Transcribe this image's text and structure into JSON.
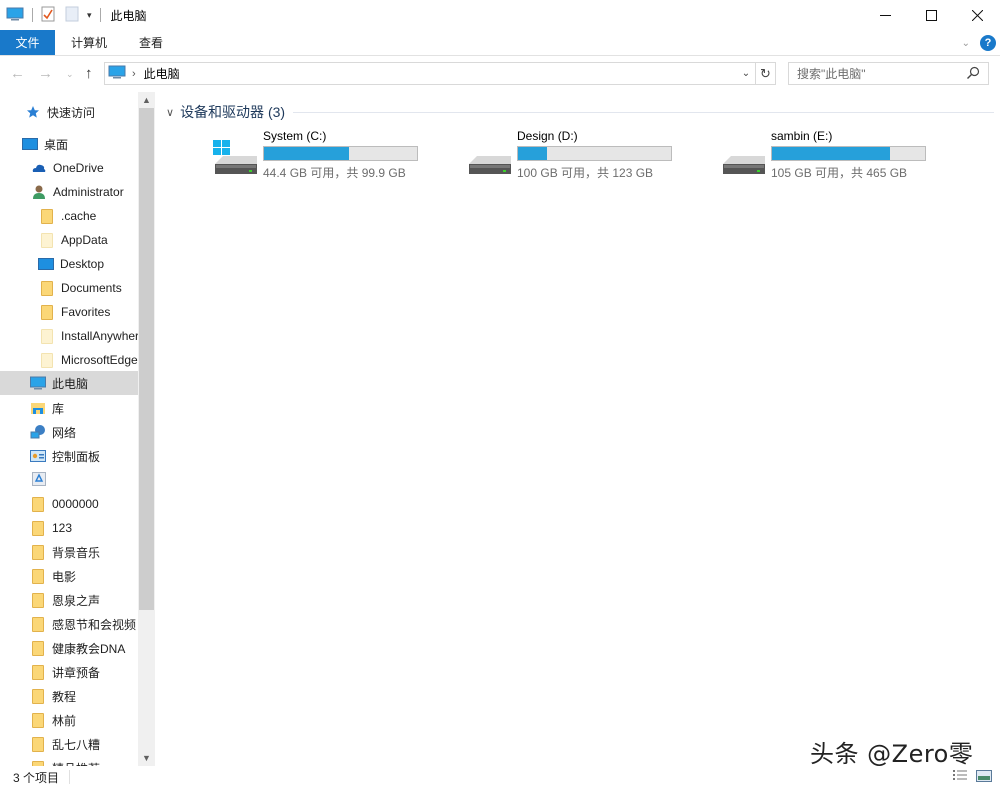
{
  "window": {
    "title": "此电脑",
    "controls": {
      "minimize": "minimize",
      "maximize": "maximize",
      "close": "close"
    }
  },
  "quick_access_toolbar": {
    "icons": [
      "computer-icon",
      "properties-icon",
      "new-folder-icon",
      "customize-dropdown-icon"
    ]
  },
  "ribbon": {
    "tabs": [
      {
        "label": "文件",
        "active": true
      },
      {
        "label": "计算机"
      },
      {
        "label": "查看"
      }
    ],
    "accent": "#1979ca"
  },
  "address_bar": {
    "breadcrumb": [
      "此电脑"
    ],
    "search_placeholder": "搜索\"此电脑\""
  },
  "nav_pane": {
    "items": [
      {
        "label": "快速访问",
        "icon": "star-icon",
        "indent": 1
      },
      {
        "label": "桌面",
        "icon": "desktop-icon",
        "indent": 0
      },
      {
        "label": "OneDrive",
        "icon": "cloud-icon",
        "indent": 1
      },
      {
        "label": "Administrator",
        "icon": "user-icon",
        "indent": 1
      },
      {
        "label": ".cache",
        "icon": "folder-icon",
        "indent": 2
      },
      {
        "label": "AppData",
        "icon": "folder-hidden-icon",
        "indent": 2
      },
      {
        "label": "Desktop",
        "icon": "desktop-icon",
        "indent": 2
      },
      {
        "label": "Documents",
        "icon": "folder-icon",
        "indent": 2
      },
      {
        "label": "Favorites",
        "icon": "folder-icon",
        "indent": 2
      },
      {
        "label": "InstallAnywhere",
        "icon": "folder-hidden-icon",
        "indent": 2
      },
      {
        "label": "MicrosoftEdgeBackups",
        "icon": "folder-hidden-icon",
        "indent": 2
      },
      {
        "label": "此电脑",
        "icon": "computer-icon",
        "indent": 1,
        "selected": true
      },
      {
        "label": "库",
        "icon": "library-icon",
        "indent": 1
      },
      {
        "label": "网络",
        "icon": "network-icon",
        "indent": 1
      },
      {
        "label": "控制面板",
        "icon": "control-panel-icon",
        "indent": 1
      },
      {
        "label": "",
        "icon": "recycle-bin-icon",
        "indent": 1
      },
      {
        "label": "0000000",
        "icon": "folder-icon",
        "indent": 1
      },
      {
        "label": "123",
        "icon": "folder-icon",
        "indent": 1
      },
      {
        "label": "背景音乐",
        "icon": "folder-icon",
        "indent": 1
      },
      {
        "label": "电影",
        "icon": "folder-icon",
        "indent": 1
      },
      {
        "label": "恩泉之声",
        "icon": "folder-icon",
        "indent": 1
      },
      {
        "label": "感恩节和会视频",
        "icon": "folder-icon",
        "indent": 1
      },
      {
        "label": "健康教会DNA",
        "icon": "folder-icon",
        "indent": 1
      },
      {
        "label": "讲章预备",
        "icon": "folder-icon",
        "indent": 1
      },
      {
        "label": "教程",
        "icon": "folder-icon",
        "indent": 1
      },
      {
        "label": "林前",
        "icon": "folder-icon",
        "indent": 1
      },
      {
        "label": "乱七八糟",
        "icon": "folder-icon",
        "indent": 1
      },
      {
        "label": "精品推荐",
        "icon": "folder-icon",
        "indent": 1
      }
    ]
  },
  "content": {
    "group_label": "设备和驱动器 (3)",
    "drives": [
      {
        "name": "System (C:)",
        "info": "44.4 GB 可用，共 99.9 GB",
        "used_percent": 55.6,
        "icon": "system-drive-icon"
      },
      {
        "name": "Design (D:)",
        "info": "100 GB 可用，共 123 GB",
        "used_percent": 18.7,
        "icon": "drive-icon"
      },
      {
        "name": "sambin (E:)",
        "info": "105 GB 可用，共 465 GB",
        "used_percent": 77.4,
        "icon": "drive-icon"
      }
    ],
    "bar_color": "#26a0da"
  },
  "status_bar": {
    "item_count": "3 个项目"
  },
  "watermark": "头条 @Zero零"
}
